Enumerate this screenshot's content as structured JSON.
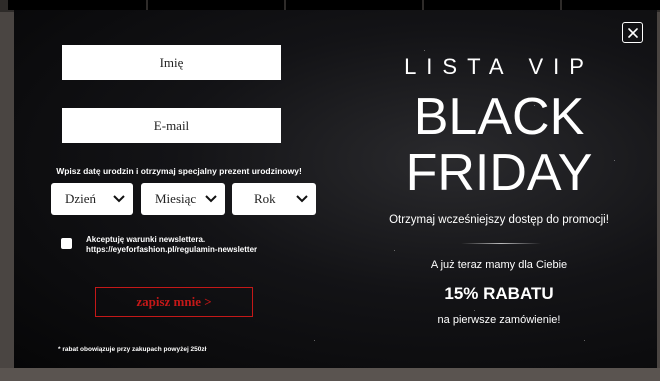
{
  "form": {
    "name_placeholder": "Imię",
    "email_placeholder": "E-mail",
    "dob_prompt": "Wpisz datę urodzin i otrzymaj specjalny prezent urodzinowy!",
    "day_label": "Dzień",
    "month_label": "Miesiąc",
    "year_label": "Rok",
    "consent_line1": "Akceptuję warunki newslettera.",
    "consent_line2": "https://eyeforfashion.pl/regulamin-newsletter",
    "consent_checked": false,
    "submit_label": "zapisz mnie >",
    "disclaimer": "* rabat obowiązuje przy zakupach powyżej 250zł"
  },
  "promo": {
    "vip_label": "LISTA VIP",
    "headline_line1": "BLACK",
    "headline_line2": "FRIDAY",
    "tagline": "Otrzymaj wcześniejszy dostęp do promocji!",
    "offer_intro": "A już teraz mamy dla Ciebie",
    "discount": "15% RABATU",
    "discount_note": "na pierwsze zamówienie!"
  },
  "close": {
    "icon": "close-icon"
  },
  "colors": {
    "submit_accent": "#c41818",
    "modal_background": "#0b0b0d",
    "text": "#ffffff"
  }
}
